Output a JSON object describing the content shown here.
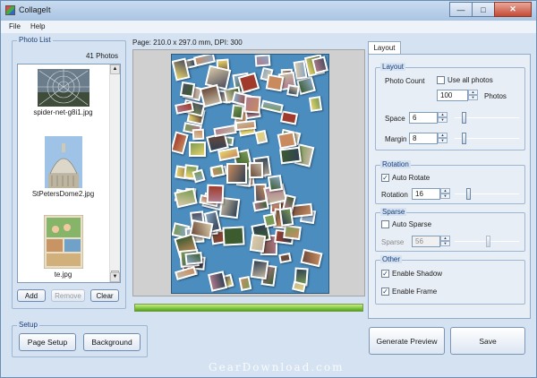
{
  "window": {
    "title": "CollageIt",
    "minimize_glyph": "—",
    "maximize_glyph": "□",
    "close_glyph": "✕"
  },
  "menu": {
    "items": [
      "File",
      "Help"
    ]
  },
  "photo_list": {
    "legend": "Photo List",
    "count": "41 Photos",
    "items": [
      {
        "name": "spider-net-g8i1.jpg",
        "icon": "spider-net-thumbnail"
      },
      {
        "name": "StPetersDome2.jpg",
        "icon": "dome-thumbnail"
      },
      {
        "name": "te.jpg",
        "icon": "family-thumbnail"
      }
    ],
    "add_label": "Add",
    "remove_label": "Remove",
    "clear_label": "Clear"
  },
  "preview": {
    "page_info": "Page: 210.0 x 297.0 mm, DPI: 300",
    "progress": 1.0,
    "paper_color": "#4b8dbf"
  },
  "tabs": {
    "layout_label": "Layout"
  },
  "layout": {
    "legend": "Layout",
    "photo_count_label": "Photo Count",
    "use_all_label": "Use all photos",
    "use_all_checked": false,
    "photo_count_value": "100",
    "photos_label": "Photos",
    "space_label": "Space",
    "space_value": "6",
    "margin_label": "Margin",
    "margin_value": "8"
  },
  "rotation": {
    "legend": "Rotation",
    "auto_rotate_label": "Auto Rotate",
    "auto_rotate_checked": true,
    "rotation_label": "Rotation",
    "rotation_value": "16"
  },
  "sparse": {
    "legend": "Sparse",
    "auto_sparse_label": "Auto Sparse",
    "auto_sparse_checked": false,
    "sparse_label": "Sparse",
    "sparse_value": "56"
  },
  "other": {
    "legend": "Other",
    "enable_shadow_label": "Enable Shadow",
    "enable_shadow_checked": true,
    "enable_frame_label": "Enable Frame",
    "enable_frame_checked": true
  },
  "setup": {
    "legend": "Setup",
    "page_setup_label": "Page Setup",
    "background_label": "Background"
  },
  "actions": {
    "generate_preview_label": "Generate Preview",
    "save_label": "Save"
  },
  "watermark": "GearDownload.com",
  "check_glyph": "✓",
  "spin_up_glyph": "▲",
  "spin_down_glyph": "▼"
}
